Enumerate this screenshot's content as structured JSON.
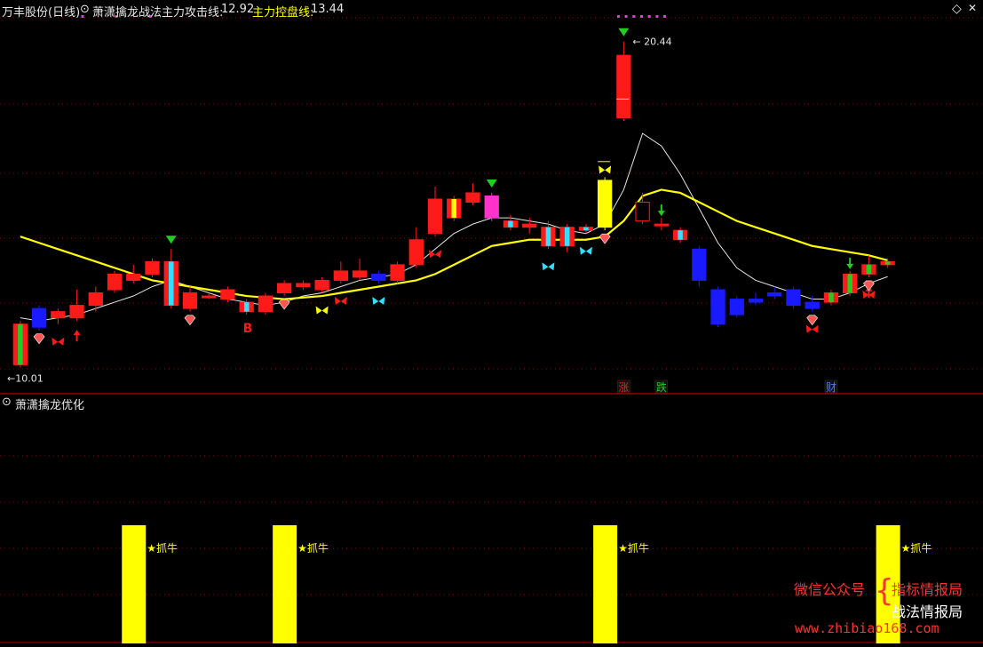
{
  "header": {
    "stock_name": "万丰股份(日线)",
    "indicator_name": "萧潇擒龙战法",
    "attack_label": "主力攻击线:",
    "attack_value": "12.92",
    "control_label": "主力控盘线:",
    "control_value": "13.44"
  },
  "lower_panel": {
    "title": "萧潇擒龙优化",
    "signal_label": "★抓牛"
  },
  "annotations": {
    "high_label": "20.44",
    "low_label": "10.01",
    "b_label": "B",
    "zhang": "涨",
    "die": "跌",
    "cai": "财"
  },
  "watermark": {
    "line1": "微信公众号",
    "line2": "指标情报局",
    "line3": "战法情报局",
    "url": "www.zhibiao168.com"
  },
  "colors": {
    "up": "#ff1a1a",
    "down": "#1a1aff",
    "green": "#22cc22",
    "cyan": "#33e0ff",
    "yellow": "#ffff00",
    "magenta": "#ff33cc",
    "ma_white": "#e6e6e6",
    "ma_yellow": "#ffff00",
    "grid": "#8b0000"
  },
  "chart_data": [
    {
      "type": "candlestick",
      "title": "萧潇擒龙战法",
      "ylim": [
        9.6,
        21.2
      ],
      "price_high": 20.44,
      "price_low": 10.01,
      "candles": [
        {
          "o": 10.1,
          "c": 11.4,
          "h": 11.5,
          "l": 10.01,
          "col": "green"
        },
        {
          "o": 11.3,
          "c": 11.9,
          "h": 12.0,
          "l": 11.2,
          "col": "blue"
        },
        {
          "o": 11.6,
          "c": 11.8,
          "h": 11.9,
          "l": 11.4,
          "col": "red"
        },
        {
          "o": 11.6,
          "c": 12.0,
          "h": 12.5,
          "l": 11.5,
          "col": "red"
        },
        {
          "o": 12.0,
          "c": 12.4,
          "h": 12.6,
          "l": 11.8,
          "col": "red"
        },
        {
          "o": 12.5,
          "c": 13.0,
          "h": 13.1,
          "l": 12.4,
          "col": "red"
        },
        {
          "o": 12.8,
          "c": 13.0,
          "h": 13.3,
          "l": 12.7,
          "col": "red"
        },
        {
          "o": 13.0,
          "c": 13.4,
          "h": 13.5,
          "l": 12.9,
          "col": "red"
        },
        {
          "o": 13.4,
          "c": 12.0,
          "h": 13.8,
          "l": 11.9,
          "col": "cyanred"
        },
        {
          "o": 12.4,
          "c": 11.9,
          "h": 12.6,
          "l": 11.8,
          "col": "red"
        },
        {
          "o": 12.3,
          "c": 12.3,
          "h": 12.4,
          "l": 12.2,
          "col": "red"
        },
        {
          "o": 12.5,
          "c": 12.2,
          "h": 12.6,
          "l": 12.1,
          "col": "red"
        },
        {
          "o": 12.1,
          "c": 11.8,
          "h": 12.2,
          "l": 11.7,
          "col": "cyanred"
        },
        {
          "o": 11.8,
          "c": 12.3,
          "h": 12.4,
          "l": 11.7,
          "col": "red"
        },
        {
          "o": 12.4,
          "c": 12.7,
          "h": 12.8,
          "l": 12.3,
          "col": "red"
        },
        {
          "o": 12.6,
          "c": 12.7,
          "h": 12.8,
          "l": 12.5,
          "col": "red"
        },
        {
          "o": 12.5,
          "c": 12.8,
          "h": 12.9,
          "l": 12.4,
          "col": "red"
        },
        {
          "o": 12.8,
          "c": 13.1,
          "h": 13.4,
          "l": 12.7,
          "col": "red"
        },
        {
          "o": 13.1,
          "c": 12.9,
          "h": 13.5,
          "l": 12.8,
          "col": "red"
        },
        {
          "o": 13.0,
          "c": 12.8,
          "h": 13.1,
          "l": 12.7,
          "col": "blue"
        },
        {
          "o": 12.8,
          "c": 13.3,
          "h": 13.4,
          "l": 12.7,
          "col": "red"
        },
        {
          "o": 13.3,
          "c": 14.1,
          "h": 14.5,
          "l": 13.2,
          "col": "red"
        },
        {
          "o": 14.3,
          "c": 15.4,
          "h": 15.8,
          "l": 14.2,
          "col": "red"
        },
        {
          "o": 15.4,
          "c": 14.8,
          "h": 15.5,
          "l": 14.7,
          "col": "yellowred"
        },
        {
          "o": 15.3,
          "c": 15.6,
          "h": 15.9,
          "l": 15.2,
          "col": "red"
        },
        {
          "o": 15.5,
          "c": 14.8,
          "h": 15.6,
          "l": 14.7,
          "col": "magenta"
        },
        {
          "o": 14.7,
          "c": 14.5,
          "h": 14.9,
          "l": 14.4,
          "col": "cyanred"
        },
        {
          "o": 14.5,
          "c": 14.6,
          "h": 14.8,
          "l": 14.3,
          "col": "red"
        },
        {
          "o": 14.5,
          "c": 13.9,
          "h": 14.7,
          "l": 13.8,
          "col": "cyanred"
        },
        {
          "o": 14.5,
          "c": 13.9,
          "h": 14.6,
          "l": 13.7,
          "col": "cyanred"
        },
        {
          "o": 14.4,
          "c": 14.5,
          "h": 14.6,
          "l": 14.3,
          "col": "cyanred"
        },
        {
          "o": 14.5,
          "c": 16.0,
          "h": 16.1,
          "l": 14.4,
          "col": "yellow"
        },
        {
          "o": 18.0,
          "c": 20.0,
          "h": 20.44,
          "l": 17.9,
          "col": "red"
        },
        {
          "o": 15.3,
          "c": 14.7,
          "h": 15.6,
          "l": 14.6,
          "col": "redhollow"
        },
        {
          "o": 14.6,
          "c": 14.6,
          "h": 14.8,
          "l": 14.4,
          "col": "red"
        },
        {
          "o": 14.4,
          "c": 14.1,
          "h": 14.5,
          "l": 14.0,
          "col": "cyanred"
        },
        {
          "o": 13.8,
          "c": 12.8,
          "h": 13.9,
          "l": 12.6,
          "col": "blue"
        },
        {
          "o": 12.5,
          "c": 11.4,
          "h": 12.6,
          "l": 11.3,
          "col": "blue"
        },
        {
          "o": 12.2,
          "c": 11.7,
          "h": 12.3,
          "l": 11.6,
          "col": "blue"
        },
        {
          "o": 12.1,
          "c": 12.2,
          "h": 12.4,
          "l": 12.0,
          "col": "blue"
        },
        {
          "o": 12.4,
          "c": 12.3,
          "h": 12.6,
          "l": 12.2,
          "col": "blue"
        },
        {
          "o": 12.5,
          "c": 12.0,
          "h": 12.6,
          "l": 11.9,
          "col": "blue"
        },
        {
          "o": 11.9,
          "c": 12.1,
          "h": 12.3,
          "l": 11.8,
          "col": "blue"
        },
        {
          "o": 12.4,
          "c": 12.1,
          "h": 12.5,
          "l": 12.0,
          "col": "greenred"
        },
        {
          "o": 12.4,
          "c": 13.0,
          "h": 13.1,
          "l": 12.3,
          "col": "greenred"
        },
        {
          "o": 13.0,
          "c": 13.3,
          "h": 13.6,
          "l": 12.9,
          "col": "greenred"
        },
        {
          "o": 13.3,
          "c": 13.4,
          "h": 13.5,
          "l": 13.2,
          "col": "greenred"
        }
      ],
      "series": [
        {
          "name": "主力攻击线",
          "color": "white",
          "values": [
            11.6,
            11.5,
            11.6,
            11.7,
            11.9,
            12.1,
            12.3,
            12.6,
            12.8,
            12.6,
            12.4,
            12.2,
            12.1,
            12.0,
            12.1,
            12.3,
            12.4,
            12.6,
            12.8,
            12.9,
            13.0,
            13.3,
            13.8,
            14.3,
            14.6,
            14.8,
            14.8,
            14.7,
            14.6,
            14.4,
            14.3,
            14.6,
            15.7,
            17.5,
            17.1,
            16.2,
            15.1,
            14.0,
            13.2,
            12.8,
            12.6,
            12.4,
            12.2,
            12.2,
            12.4,
            12.7,
            12.92
          ]
        },
        {
          "name": "主力控盘线",
          "color": "yellow",
          "values": [
            14.2,
            14.0,
            13.8,
            13.6,
            13.4,
            13.2,
            13.0,
            12.8,
            12.7,
            12.6,
            12.5,
            12.4,
            12.3,
            12.25,
            12.2,
            12.25,
            12.3,
            12.4,
            12.5,
            12.6,
            12.7,
            12.8,
            13.0,
            13.3,
            13.6,
            13.9,
            14.0,
            14.1,
            14.1,
            14.1,
            14.1,
            14.2,
            14.7,
            15.5,
            15.7,
            15.6,
            15.3,
            15.0,
            14.7,
            14.5,
            14.3,
            14.1,
            13.9,
            13.8,
            13.7,
            13.6,
            13.44
          ]
        }
      ]
    },
    {
      "type": "bar",
      "title": "萧潇擒龙优化",
      "label": "★抓牛",
      "x": [
        6,
        14,
        31,
        46
      ],
      "values": [
        1,
        1,
        1,
        1
      ]
    }
  ]
}
